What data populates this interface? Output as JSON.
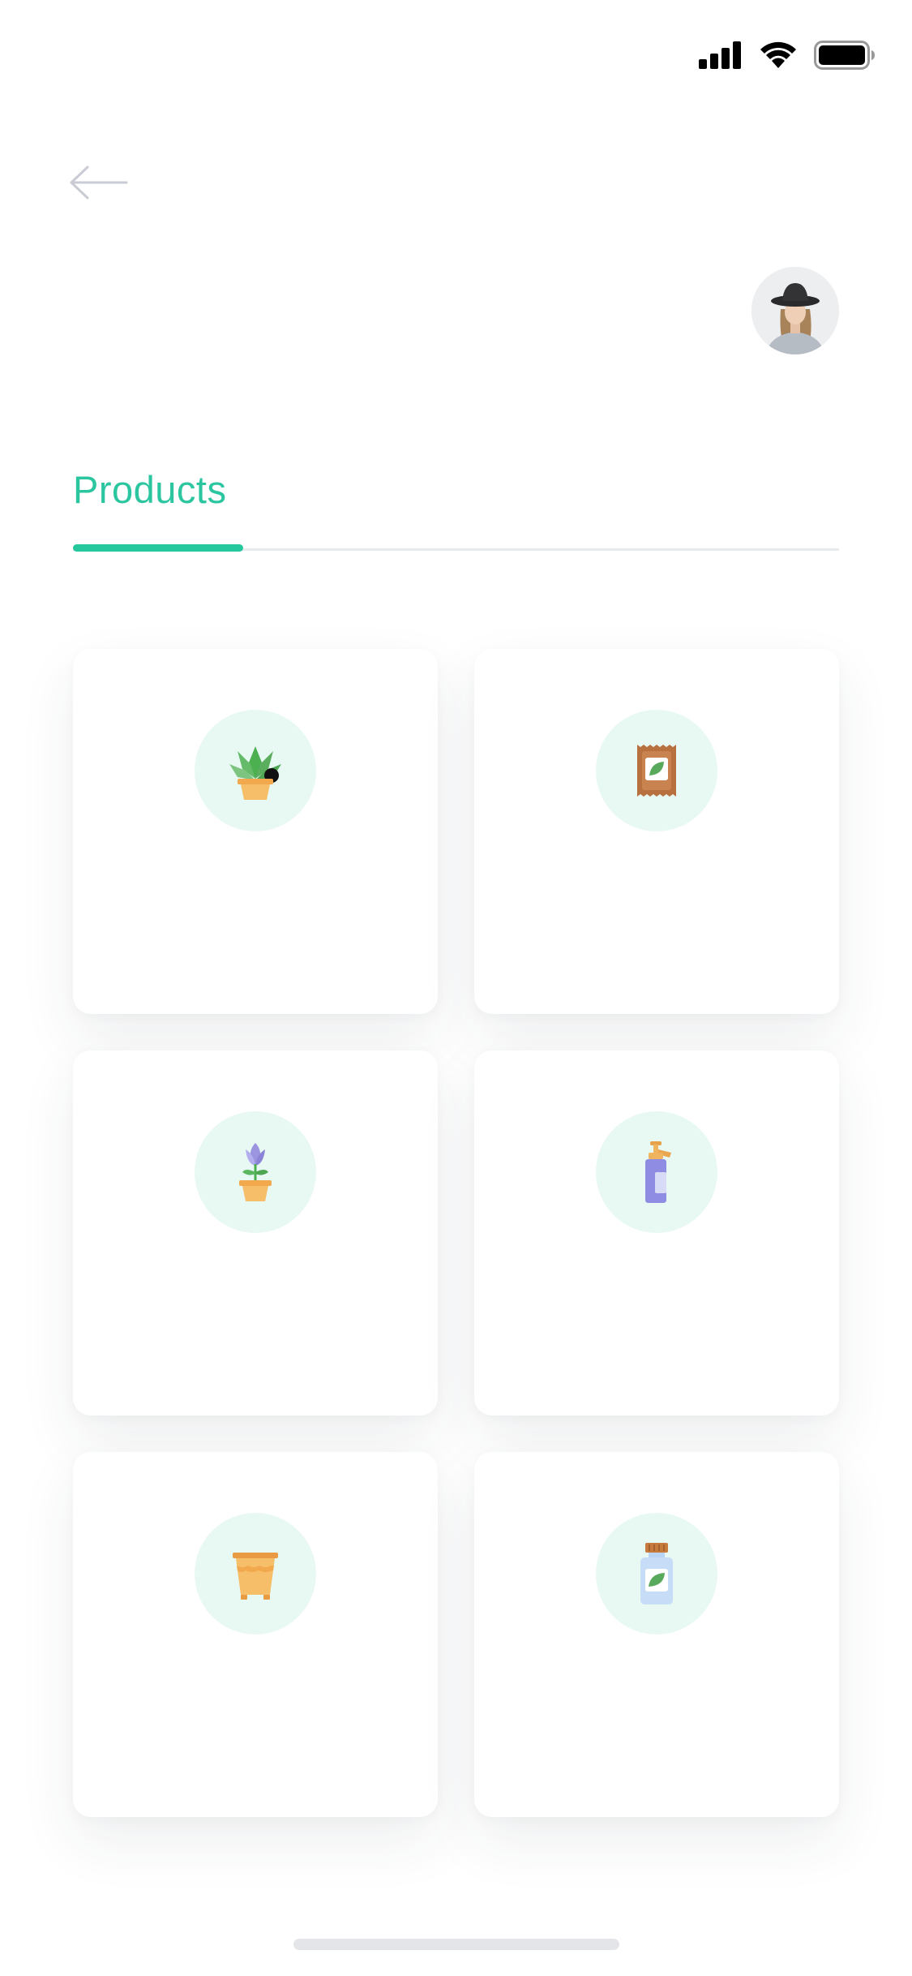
{
  "status_bar": {
    "icons": [
      "signal-icon",
      "wifi-icon",
      "battery-icon"
    ]
  },
  "header": {
    "back_icon": "arrow-left-icon",
    "avatar": "user-avatar-photo"
  },
  "tabs": [
    {
      "label": "Products",
      "active": true
    }
  ],
  "colors": {
    "accent": "#25c79c",
    "tab_text": "#2bc6a0",
    "icon_circle_bg": "#e8f8f3",
    "card_bg": "#ffffff"
  },
  "products": [
    {
      "icon": "potted-plant-icon"
    },
    {
      "icon": "soil-bag-icon"
    },
    {
      "icon": "flower-pot-icon"
    },
    {
      "icon": "spray-bottle-icon"
    },
    {
      "icon": "empty-pot-icon"
    },
    {
      "icon": "fertilizer-jar-icon"
    }
  ]
}
